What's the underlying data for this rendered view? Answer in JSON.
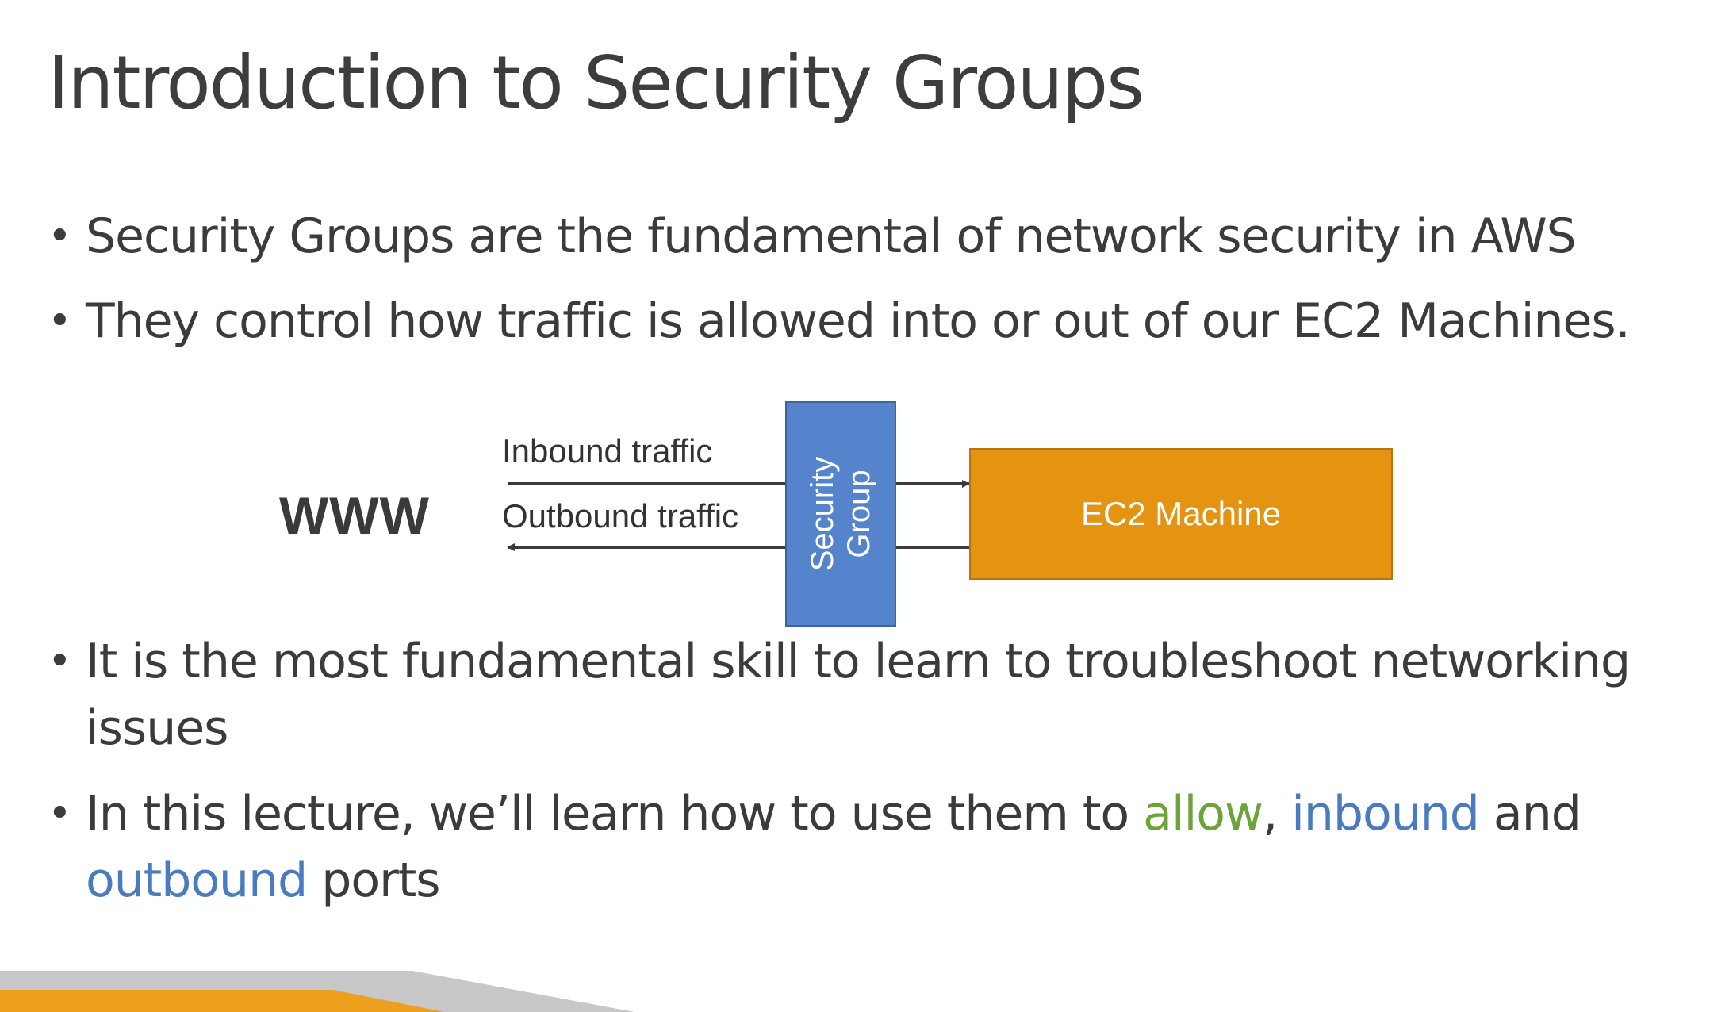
{
  "slide": {
    "title": "Introduction to Security Groups"
  },
  "bullets": [
    {
      "marker": "•",
      "text": "Security Groups are the fundamental of network security in AWS"
    },
    {
      "marker": "•",
      "text": "They control how traffic is allowed into or out of our EC2 Machines."
    },
    {
      "marker": "•",
      "text": "It is the most fundamental skill to learn to troubleshoot networking issues"
    },
    {
      "marker": "•",
      "parts": {
        "intro": "In this lecture, we’ll learn how to use them to ",
        "allow": "allow",
        "comma": ", ",
        "inbound": "inbound",
        "and": " and ",
        "outbound": "outbound",
        "ports": " ports"
      }
    }
  ],
  "diagram": {
    "www_label": "WWW",
    "inbound_label": "Inbound traffic",
    "outbound_label": "Outbound traffic",
    "security_group_label_line1": "Security",
    "security_group_label_line2": "Group",
    "ec2_label": "EC2 Machine"
  },
  "colors": {
    "highlight_green": "#6ea33a",
    "highlight_blue": "#4a7bc0",
    "security_group_fill": "#5584cc",
    "ec2_fill": "#e59412",
    "footer_orange": "#eca01e",
    "footer_gray": "#c8c8c8"
  }
}
